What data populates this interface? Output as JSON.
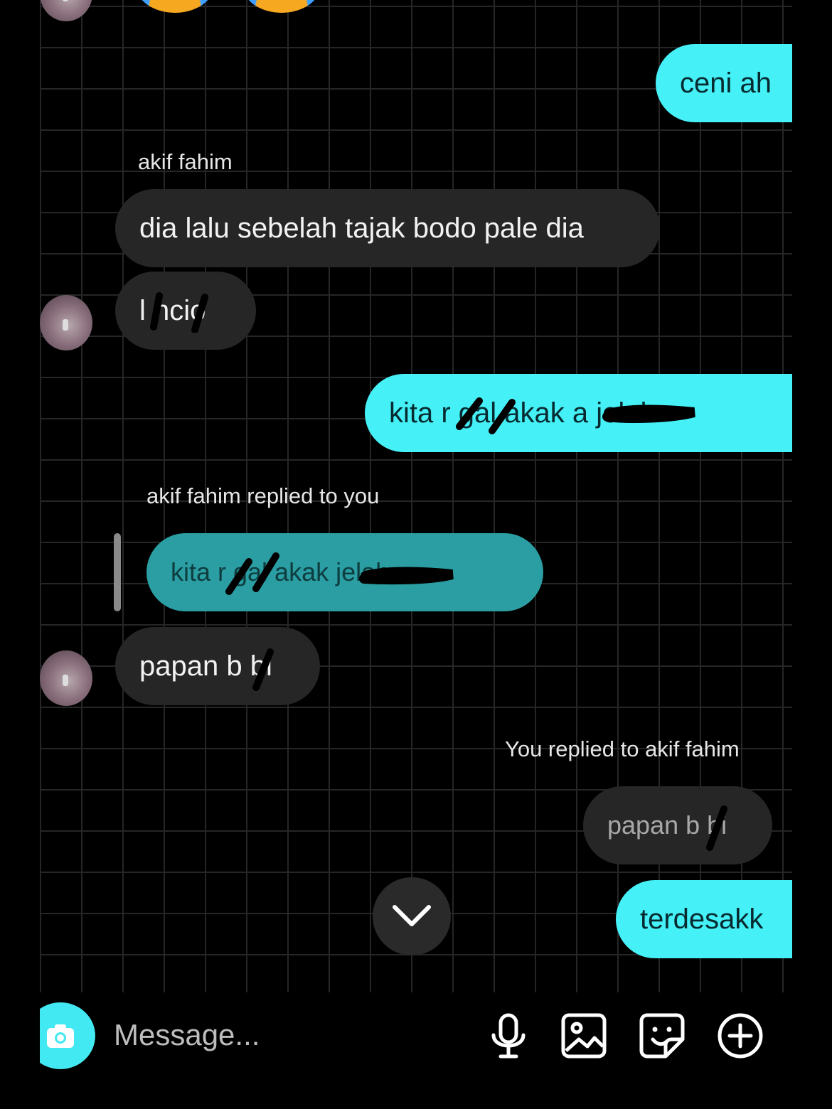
{
  "messages": {
    "m1": "ceni ah",
    "sender1": "akif fahim",
    "m2": "dia lalu sebelah tajak bodo pale dia",
    "m3": "l ncio",
    "m4": "kita r gal akak a jelah",
    "reply_label1": "akif fahim replied to you",
    "quoted1": "kita r gal akak jelah",
    "m5": "papan b bi",
    "reply_label2": "You replied to akif fahim",
    "quoted2": "papan b bi",
    "m6": "terdesakk"
  },
  "composer": {
    "placeholder": "Message..."
  },
  "icons": {
    "camera": "camera-icon",
    "mic": "microphone-icon",
    "gallery": "image-icon",
    "sticker": "sticker-icon",
    "more": "plus-circle-icon",
    "scroll": "chevron-down-icon"
  },
  "colors": {
    "my_bubble": "#45f0f6",
    "their_bubble": "#262626",
    "quoted_bubble": "#2a9ea2",
    "background": "#000000"
  }
}
